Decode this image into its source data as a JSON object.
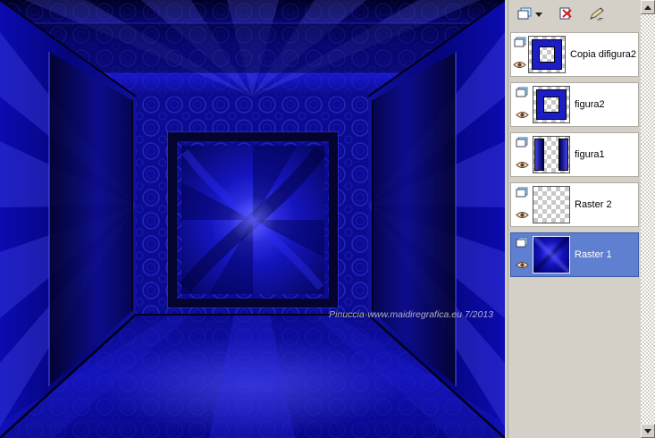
{
  "canvas": {
    "watermark": "Pinuccia-www.maidiregrafica.eu 7/2013",
    "dominant_color": "#0a0aa0"
  },
  "layers_panel": {
    "toolbar": {
      "buttons": [
        {
          "icon": "new-layer-icon"
        },
        {
          "icon": "delete-layer-icon"
        },
        {
          "icon": "pen-icon"
        }
      ]
    },
    "selection_color": "#5f7fd0",
    "layers": [
      {
        "label": "Copia difigura2",
        "selected": false,
        "thumbnail": "blue-frame-on-transparent"
      },
      {
        "label": "figura2",
        "selected": false,
        "thumbnail": "blue-frame-on-transparent"
      },
      {
        "label": "figura1",
        "selected": false,
        "thumbnail": "blue-side-bars-on-transparent"
      },
      {
        "label": "Raster 2",
        "selected": false,
        "thumbnail": "transparent"
      },
      {
        "label": "Raster 1",
        "selected": true,
        "thumbnail": "solid-blue-burst"
      }
    ]
  }
}
